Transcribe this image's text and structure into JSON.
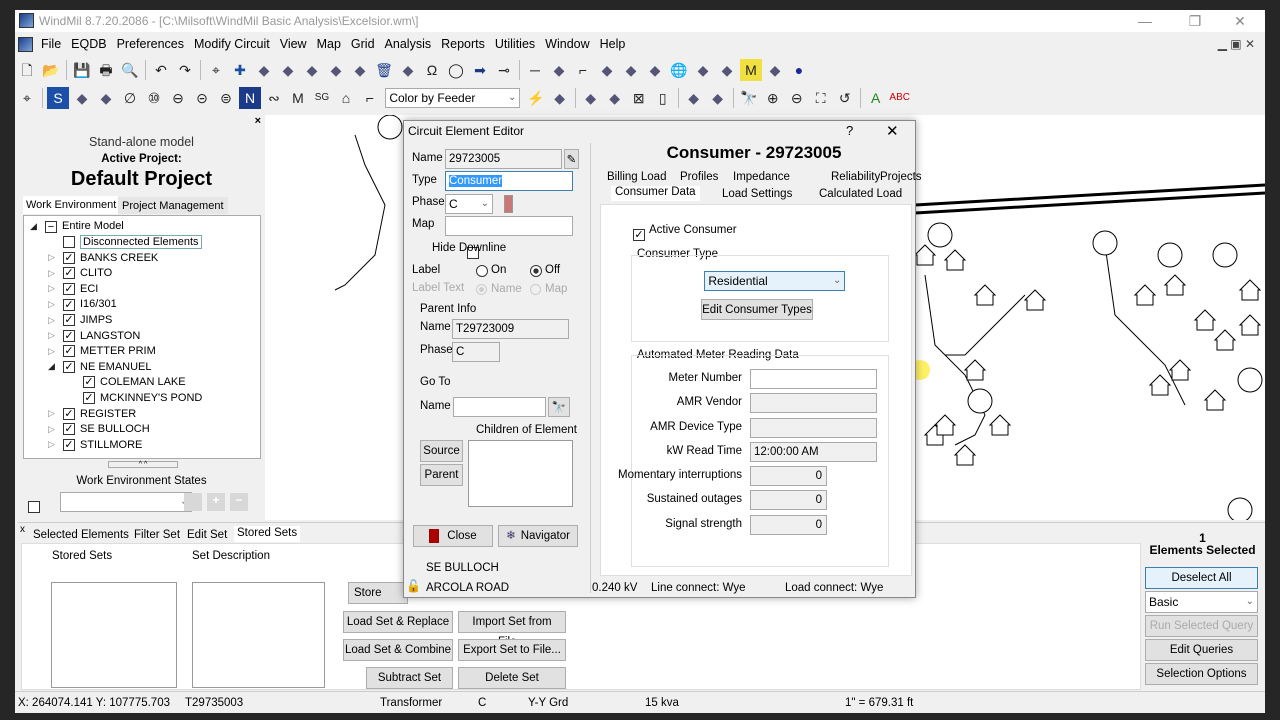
{
  "window": {
    "title": "WindMil 8.7.20.2086 - [C:\\Milsoft\\WindMil Basic Analysis\\Excelsior.wm\\]",
    "minimize": "—",
    "restore": "❐",
    "close": "✕"
  },
  "menu": [
    "File",
    "EQDB",
    "Preferences",
    "Modify Circuit",
    "View",
    "Map",
    "Grid",
    "Analysis",
    "Reports",
    "Utilities",
    "Window",
    "Help"
  ],
  "toolbar1": [
    "new-file",
    "open-folder",
    "save",
    "print",
    "print-preview",
    "undo",
    "redo",
    "edit-mode",
    "add-element",
    "disconnect",
    "connect",
    "insert",
    "plug-in",
    "plug-out",
    "delete",
    "split",
    "loop",
    "cycle",
    "arrow-right",
    "switch-open",
    "switch-line",
    "node-line",
    "hook",
    "wrench-circle",
    "bar-chart",
    "spectrum",
    "globe",
    "tree",
    "grid-window",
    "meter",
    "legend",
    "bomb"
  ],
  "toolbar2": [
    "edit-mode",
    "source",
    "overhead-line",
    "underground-line",
    "phase",
    "regulator",
    "transformer",
    "capacitor",
    "reactor",
    "node",
    "generator",
    "motor",
    "sg",
    "house",
    "hook"
  ],
  "toolbar2b": [
    "lightning",
    "report",
    "paste",
    "copy",
    "delete-doc",
    "blank-doc",
    "color-grid",
    "dark-grid",
    "binoculars",
    "zoom-in",
    "zoom-out",
    "zoom-fit",
    "zoom-back",
    "label-a",
    "label-abc"
  ],
  "color_by": "Color by Feeder",
  "left": {
    "model": "Stand-alone model",
    "active_label": "Active Project:",
    "project": "Default Project",
    "tabs": [
      "Work Environment",
      "Project Management"
    ],
    "tree": [
      {
        "label": "Entire Model",
        "level": 0,
        "exp": "open",
        "check": "partial"
      },
      {
        "label": "Disconnected Elements",
        "level": 1,
        "exp": "",
        "check": "off"
      },
      {
        "label": "BANKS CREEK",
        "level": 1,
        "exp": "closed",
        "check": "on"
      },
      {
        "label": "CLITO",
        "level": 1,
        "exp": "closed",
        "check": "on"
      },
      {
        "label": "ECI",
        "level": 1,
        "exp": "closed",
        "check": "on"
      },
      {
        "label": "I16/301",
        "level": 1,
        "exp": "closed",
        "check": "on"
      },
      {
        "label": "JIMPS",
        "level": 1,
        "exp": "closed",
        "check": "on"
      },
      {
        "label": "LANGSTON",
        "level": 1,
        "exp": "closed",
        "check": "on"
      },
      {
        "label": "METTER PRIM",
        "level": 1,
        "exp": "closed",
        "check": "on"
      },
      {
        "label": "NE EMANUEL",
        "level": 1,
        "exp": "open",
        "check": "on"
      },
      {
        "label": "COLEMAN LAKE",
        "level": 2,
        "exp": "",
        "check": "on"
      },
      {
        "label": "MCKINNEY'S POND",
        "level": 2,
        "exp": "",
        "check": "on"
      },
      {
        "label": "REGISTER",
        "level": 1,
        "exp": "closed",
        "check": "on"
      },
      {
        "label": "SE BULLOCH",
        "level": 1,
        "exp": "closed",
        "check": "on"
      },
      {
        "label": "STILLMORE",
        "level": 1,
        "exp": "closed",
        "check": "on"
      }
    ],
    "states_label": "Work Environment States"
  },
  "dialog": {
    "title": "Circuit Element Editor",
    "help": "?",
    "close": "✕",
    "name_label": "Name",
    "name": "29723005",
    "type_label": "Type",
    "type": "Consumer",
    "phase_label": "Phase",
    "phase": "C",
    "map_label": "Map",
    "map": "",
    "hide_downline": "Hide Downline",
    "label_label": "Label",
    "on": "On",
    "off": "Off",
    "label_text": "Label Text",
    "name_opt": "Name",
    "map_opt": "Map",
    "parent_info": "Parent Info",
    "parent_name_label": "Name",
    "parent_name": "T29723009",
    "parent_phase_label": "Phase",
    "parent_phase": "C",
    "goto": "Go To",
    "goto_name_label": "Name",
    "goto_name": "",
    "children": "Children of Element",
    "source": "Source",
    "parent": "Parent",
    "close_btn": "Close",
    "navigator": "Navigator",
    "header": "Consumer - 29723005",
    "tabs_row1": [
      "Billing Load",
      "Profiles",
      "Impedance",
      "Reliability",
      "Projects"
    ],
    "tabs_row2": [
      "Consumer Data",
      "Load Settings",
      "Calculated Load"
    ],
    "active_consumer": "Active Consumer",
    "consumer_type_label": "Consumer Type",
    "consumer_type": "Residential",
    "edit_types": "Edit Consumer Types",
    "amr_label": "Automated Meter Reading Data",
    "amr": [
      {
        "label": "Meter Number",
        "value": ""
      },
      {
        "label": "AMR Vendor",
        "value": ""
      },
      {
        "label": "AMR Device Type",
        "value": ""
      },
      {
        "label": "kW Read Time",
        "value": "12:00:00 AM"
      }
    ],
    "counts": [
      {
        "label": "Momentary interruptions",
        "value": "0"
      },
      {
        "label": "Sustained outages",
        "value": "0"
      },
      {
        "label": "Signal strength",
        "value": "0"
      }
    ],
    "status": {
      "substation": "SE BULLOCH",
      "feeder": "ARCOLA ROAD",
      "kv": "0.240 kV",
      "line": "Line connect: Wye",
      "load": "Load connect: Wye"
    }
  },
  "bottom": {
    "close": "x",
    "tabs": [
      "Selected Elements",
      "Filter Set",
      "Edit Set",
      "Stored Sets"
    ],
    "stored_sets": "Stored Sets",
    "set_description": "Set Description",
    "buttons": [
      "Store Current",
      "Load Set & Replace",
      "Import Set from File...",
      "Load Set & Combine",
      "Export Set to File...",
      "Subtract Set",
      "Delete Set"
    ],
    "count": "1",
    "selected_label": "Elements Selected",
    "deselect": "Deselect All Elements",
    "query": "Basic",
    "run_query": "Run Selected Query",
    "edit_queries": "Edit Queries",
    "selection_options": "Selection Options"
  },
  "statusbar": {
    "coords": "X: 264074.141  Y: 107775.703",
    "element": "T29735003",
    "kind": "Transformer",
    "phase": "C",
    "conn": "Y-Y Grd",
    "size": "15 kva",
    "scale": "1\" = 679.31 ft"
  }
}
